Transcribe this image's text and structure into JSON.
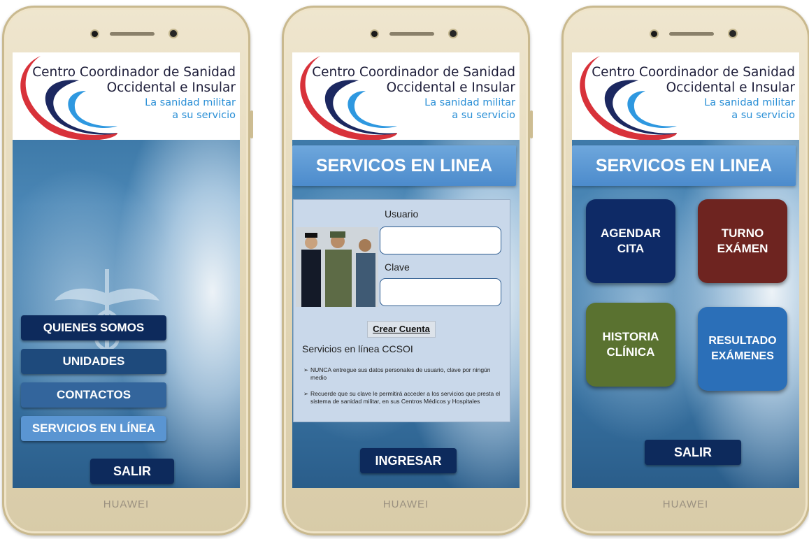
{
  "header": {
    "line1": "Centro Coordinador de Sanidad",
    "line2": "Occidental e Insular",
    "line3": "La sanidad militar",
    "line4": "a su servicio"
  },
  "device_brand": "HUAWEI",
  "screen1": {
    "menu": [
      "QUIENES SOMOS",
      "UNIDADES",
      "CONTACTOS",
      "SERVICIOS EN LÍNEA"
    ],
    "exit_label": "SALIR"
  },
  "screen2": {
    "banner": "SERVICOS EN LINEA",
    "username_label": "Usuario",
    "username_value": "",
    "password_label": "Clave",
    "password_value": "",
    "create_account": "Crear Cuenta",
    "services_title": "Servicios en línea CCSOI",
    "bullet_glyph": "➢",
    "note1": "NUNCA entregue sus datos personales de usuario, clave por ningún medio",
    "note2": "Recuerde que su clave le permitirá acceder a los servicios que presta el sistema de sanidad militar, en sus Centros Médicos y Hospitales",
    "login_label": "INGRESAR"
  },
  "screen3": {
    "banner": "SERVICOS EN LINEA",
    "tiles": [
      {
        "line1": "AGENDAR",
        "line2": "CITA",
        "color": "#0e2a66"
      },
      {
        "line1": "TURNO",
        "line2": "EXÁMEN",
        "color": "#6e2420"
      },
      {
        "line1": "HISTORIA",
        "line2": "CLÍNICA",
        "color": "#5a7230"
      },
      {
        "line1": "RESULTADO",
        "line2": "EXÁMENES",
        "color": "#2b6fb8"
      }
    ],
    "exit_label": "SALIR"
  },
  "colors": {
    "navy_button": "#0d2a5c",
    "banner_blue": "#4c8bcc",
    "header_text": "#1e1e3a",
    "tagline_blue": "#2a8fd6"
  }
}
